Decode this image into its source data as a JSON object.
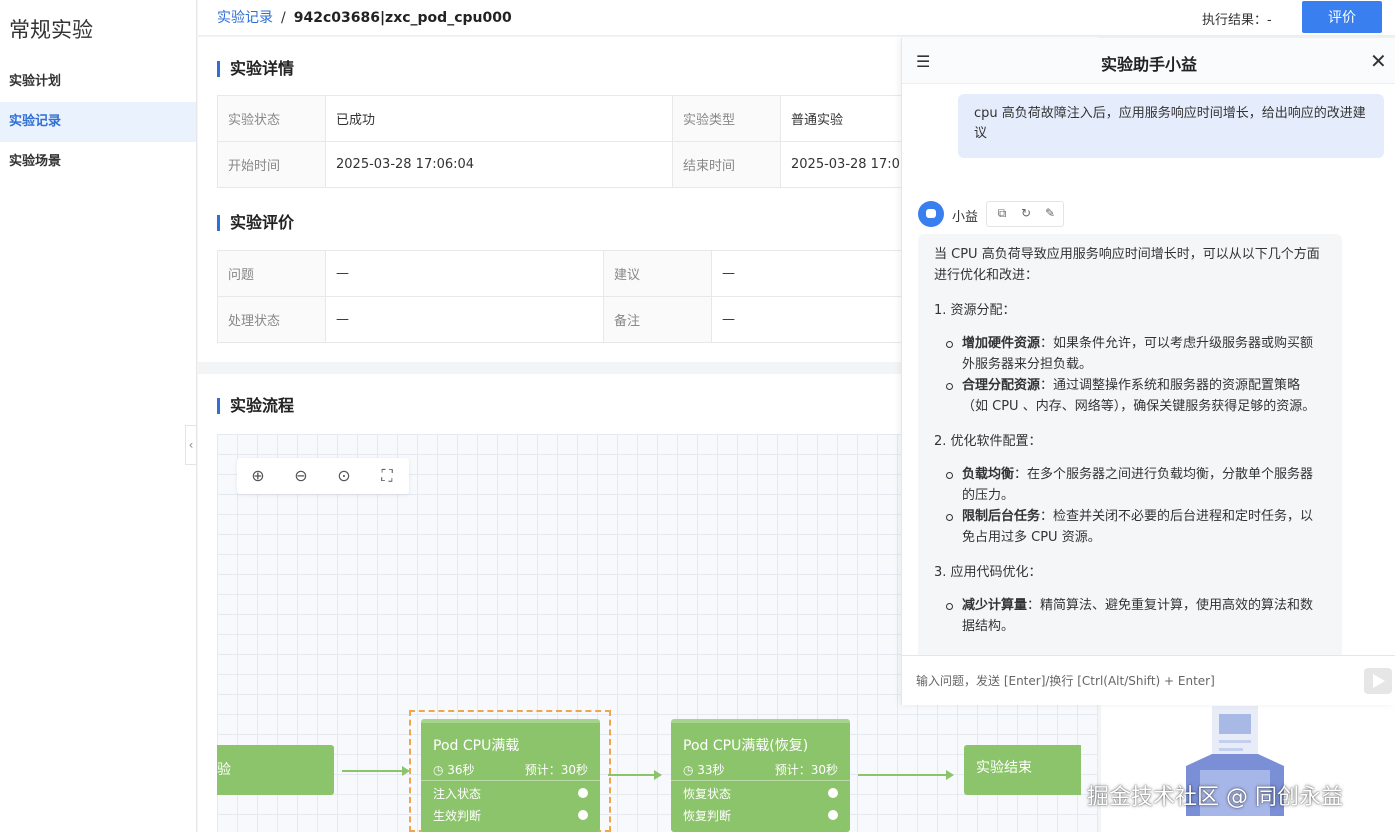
{
  "sidebar": {
    "title": "常规实验",
    "items": [
      {
        "label": "实验计划"
      },
      {
        "label": "实验记录"
      },
      {
        "label": "实验场景"
      }
    ]
  },
  "header": {
    "breadcrumb_link": "实验记录",
    "breadcrumb_sep": "/",
    "breadcrumb_current": "942c03686|zxc_pod_cpu000",
    "exec_result": "执行结果：-",
    "rate_label": "评价"
  },
  "details": {
    "title": "实验详情",
    "rows": [
      {
        "k1": "实验状态",
        "v1": "已成功",
        "k2": "实验类型",
        "v2": "普通实验"
      },
      {
        "k1": "开始时间",
        "v1": "2025-03-28 17:06:04",
        "k2": "结束时间",
        "v2": "2025-03-28 17:0"
      }
    ]
  },
  "evaluation": {
    "title": "实验评价",
    "rows": [
      {
        "k1": "问题",
        "v1": "—",
        "k2": "建议",
        "v2": "—"
      },
      {
        "k1": "处理状态",
        "v1": "—",
        "k2": "备注",
        "v2": "—"
      }
    ]
  },
  "flow": {
    "title": "实验流程",
    "nodes": [
      {
        "title": "验",
        "id": "start"
      },
      {
        "title": "Pod CPU满载",
        "time": "◷ 36秒",
        "expect": "预计：30秒",
        "s1": "注入状态",
        "s2": "生效判断"
      },
      {
        "title": "Pod CPU满载(恢复)",
        "time": "◷ 33秒",
        "expect": "预计：30秒",
        "s1": "恢复状态",
        "s2": "恢复判断"
      },
      {
        "title": "实验结束"
      }
    ]
  },
  "assistant": {
    "title": "实验助手小益",
    "user_message": "cpu 高负荷故障注入后，应用服务响应时间增长，给出响应的改进建议",
    "bot_name": "小益",
    "answer": {
      "intro": "当 CPU 高负荷导致应用服务响应时间增长时，可以从以下几个方面进行优化和改进：",
      "sections": [
        {
          "heading": "1. 资源分配：",
          "bullets": [
            {
              "bold": "增加硬件资源",
              "text": "：如果条件允许，可以考虑升级服务器或购买额外服务器来分担负载。"
            },
            {
              "bold": "合理分配资源",
              "text": "：通过调整操作系统和服务器的资源配置策略（如 CPU 、内存、网络等），确保关键服务获得足够的资源。"
            }
          ]
        },
        {
          "heading": "2. 优化软件配置：",
          "bullets": [
            {
              "bold": "负载均衡",
              "text": "：在多个服务器之间进行负载均衡，分散单个服务器的压力。"
            },
            {
              "bold": "限制后台任务",
              "text": "：检查并关闭不必要的后台进程和定时任务，以免占用过多 CPU 资源。"
            }
          ]
        },
        {
          "heading": "3. 应用代码优化：",
          "bullets": [
            {
              "bold": "减少计算量",
              "text": "：精简算法、避免重复计算，使用高效的算法和数据结构。"
            }
          ]
        }
      ]
    },
    "input_placeholder": "输入问题，发送 [Enter]/换行 [Ctrl(Alt/Shift) + Enter]"
  },
  "watermark": "掘金技术社区 @ 同创永益"
}
